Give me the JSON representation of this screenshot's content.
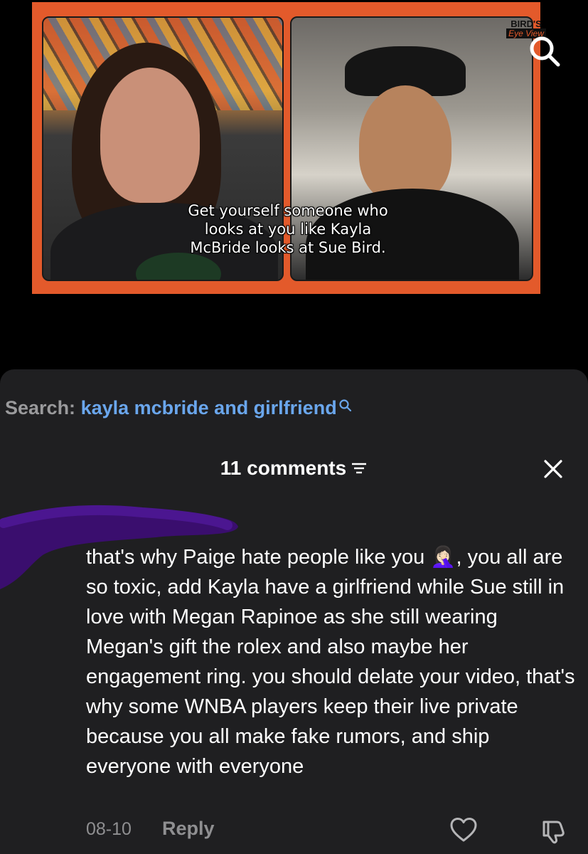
{
  "video": {
    "caption_lines": [
      "Get yourself someone who",
      "looks at you like Kayla",
      "McBride looks at Sue Bird."
    ],
    "logo_top": "BIRD'S",
    "logo_script": "Eye View",
    "frame_color": "#e35a2b",
    "search_icon": "search-icon"
  },
  "search": {
    "label": "Search:",
    "query": "kayla mcbride and girlfriend",
    "query_color": "#6aa6ec"
  },
  "comments_header": {
    "title": "11 comments",
    "filter_icon": "filter-icon",
    "close_icon": "close-icon"
  },
  "comment": {
    "text": "that's why Paige hate people like you 🤦🏻‍♀️, you all are so toxic, add Kayla have a girlfriend while Sue still in love with Megan Rapinoe as she still wearing Megan's gift the rolex and also maybe her engagement ring. you should delate your video, that's why some WNBA players keep their live private because you all make fake rumors, and ship everyone with everyone",
    "date": "08-10",
    "reply_label": "Reply",
    "like_icon": "heart-icon",
    "dislike_icon": "dislike-icon",
    "redaction_color": "#3a0e6e"
  }
}
